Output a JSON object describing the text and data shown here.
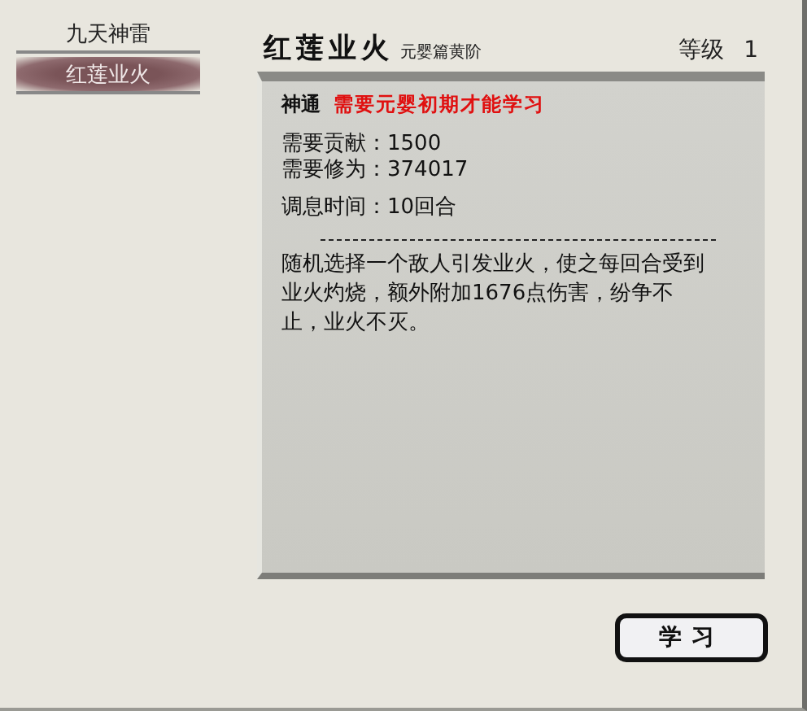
{
  "sidebar": {
    "items": [
      {
        "label": "九天神雷",
        "selected": false
      },
      {
        "label": "红莲业火",
        "selected": true
      }
    ]
  },
  "skill": {
    "name": "红莲业火",
    "tier": "元婴篇黄阶",
    "level_label": "等级",
    "level": "1"
  },
  "detail": {
    "type_label": "神通",
    "requirement": "需要元婴初期才能学习",
    "stats": [
      {
        "label": "需要贡献：",
        "value": "1500"
      },
      {
        "label": "需要修为：",
        "value": "374017"
      }
    ],
    "rest": {
      "label": "调息时间：",
      "value": "10回合"
    },
    "description": "随机选择一个敌人引发业火，使之每回合受到业火灼烧，额外附加1676点伤害，纷争不止，业火不灭。"
  },
  "buttons": [
    {
      "label": "学习"
    }
  ]
}
